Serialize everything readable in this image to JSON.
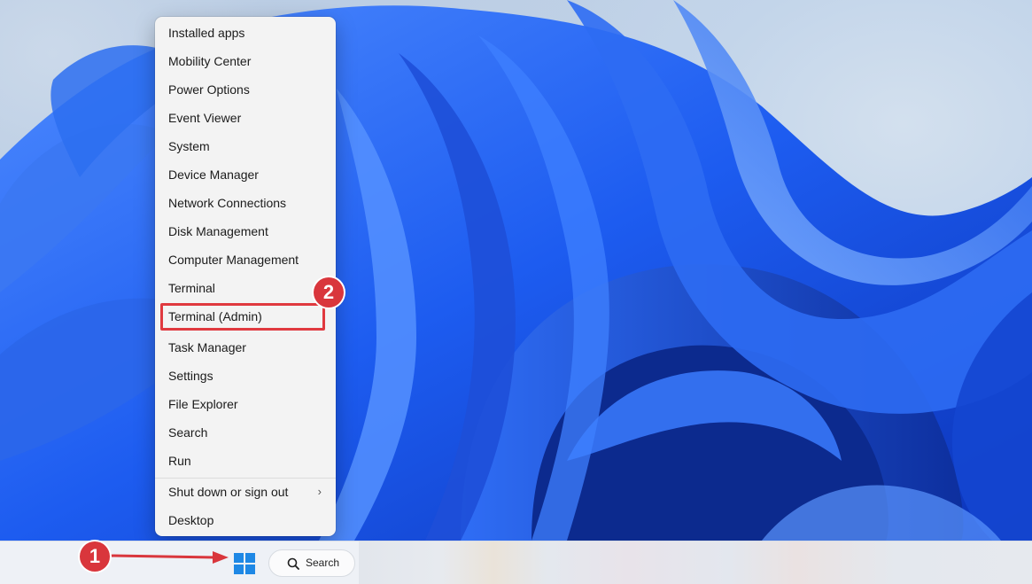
{
  "menu": {
    "items": [
      {
        "label": "Installed apps"
      },
      {
        "label": "Mobility Center"
      },
      {
        "label": "Power Options"
      },
      {
        "label": "Event Viewer"
      },
      {
        "label": "System"
      },
      {
        "label": "Device Manager"
      },
      {
        "label": "Network Connections"
      },
      {
        "label": "Disk Management"
      },
      {
        "label": "Computer Management"
      },
      {
        "label": "Terminal"
      },
      {
        "label": "Terminal (Admin)"
      },
      {
        "label": "Task Manager"
      },
      {
        "label": "Settings"
      },
      {
        "label": "File Explorer"
      },
      {
        "label": "Search"
      },
      {
        "label": "Run"
      },
      {
        "label": "Shut down or sign out"
      },
      {
        "label": "Desktop"
      }
    ],
    "submenu_chevron": "›"
  },
  "annotations": {
    "step1": "1",
    "step2": "2",
    "highlight_color": "#e0393f"
  },
  "taskbar": {
    "start_icon": "windows-logo-icon",
    "search_label": "Search",
    "search_icon": "search-icon"
  },
  "colors": {
    "wallpaper_blue": "#1a55e8",
    "menu_bg": "#f3f3f3",
    "badge_red": "#d9363c"
  }
}
